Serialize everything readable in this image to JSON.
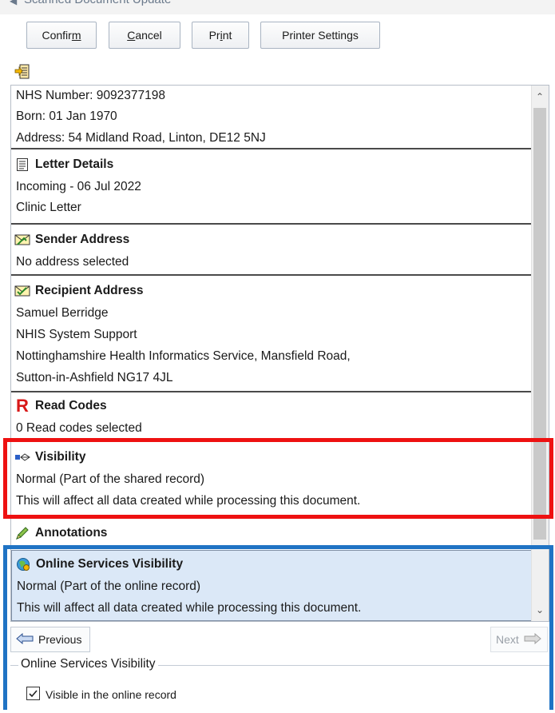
{
  "window": {
    "title": "Scanned Document Update"
  },
  "toolbar": {
    "confirm_pre": "Confir",
    "confirm_key": "m",
    "confirm_post": "",
    "cancel_pre": "",
    "cancel_key": "C",
    "cancel_post": "ancel",
    "print_pre": "Pr",
    "print_key": "i",
    "print_post": "nt",
    "printer_settings": "Printer Settings"
  },
  "patient": {
    "nhs_number": "NHS Number: 9092377198",
    "born": "Born: 01 Jan 1970",
    "address": "Address: 54 Midland Road, Linton, DE12 5NJ"
  },
  "letter_details": {
    "heading": "Letter Details",
    "line1": "Incoming - 06 Jul 2022",
    "line2": "Clinic Letter"
  },
  "sender_address": {
    "heading": "Sender Address",
    "line1": "No address selected"
  },
  "recipient_address": {
    "heading": "Recipient Address",
    "line1": "Samuel Berridge",
    "line2": "NHIS System Support",
    "line3": "Nottinghamshire Health Informatics Service, Mansfield Road,",
    "line4": "Sutton-in-Ashfield NG17 4JL"
  },
  "read_codes": {
    "heading": "Read Codes",
    "icon_letter": "R",
    "line1": "0 Read codes selected"
  },
  "visibility": {
    "heading": "Visibility",
    "line1": "Normal (Part of the shared record)",
    "line2": "This will affect all data created while processing this document."
  },
  "annotations": {
    "heading": "Annotations"
  },
  "online_visibility": {
    "heading": "Online Services Visibility",
    "line1": "Normal (Part of the online record)",
    "line2": "This will affect all data created while processing this document."
  },
  "nav": {
    "previous": "Previous",
    "next": "Next"
  },
  "online_group": {
    "legend": "Online Services Visibility",
    "checkbox_label": "Visible in the online record",
    "checked": true
  },
  "colors": {
    "highlight_red": "#ee1111",
    "highlight_blue": "#1f73c4",
    "selected_row": "#dbe8f7"
  }
}
